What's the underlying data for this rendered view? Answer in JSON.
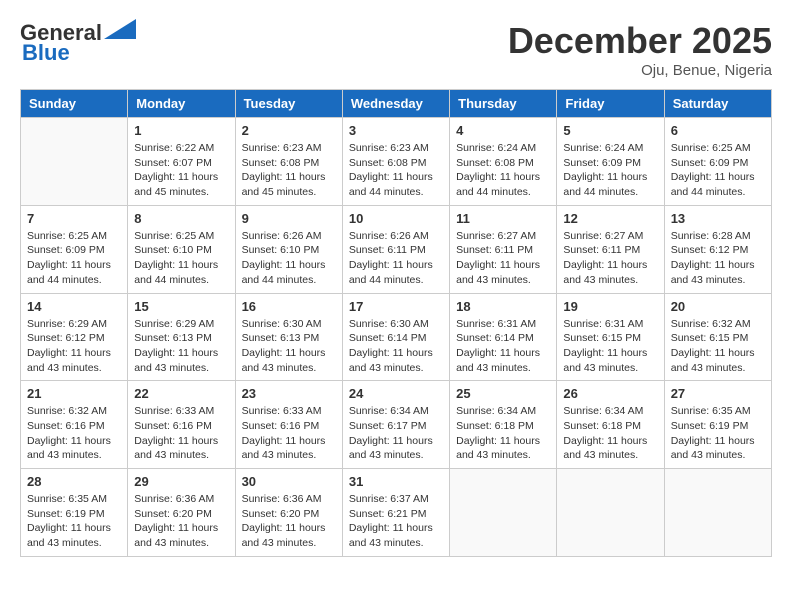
{
  "header": {
    "logo_line1": "General",
    "logo_line2": "Blue",
    "month": "December 2025",
    "location": "Oju, Benue, Nigeria"
  },
  "weekdays": [
    "Sunday",
    "Monday",
    "Tuesday",
    "Wednesday",
    "Thursday",
    "Friday",
    "Saturday"
  ],
  "weeks": [
    [
      {
        "day": "",
        "sunrise": "",
        "sunset": "",
        "daylight": ""
      },
      {
        "day": "1",
        "sunrise": "6:22 AM",
        "sunset": "6:07 PM",
        "daylight": "11 hours and 45 minutes."
      },
      {
        "day": "2",
        "sunrise": "6:23 AM",
        "sunset": "6:08 PM",
        "daylight": "11 hours and 45 minutes."
      },
      {
        "day": "3",
        "sunrise": "6:23 AM",
        "sunset": "6:08 PM",
        "daylight": "11 hours and 44 minutes."
      },
      {
        "day": "4",
        "sunrise": "6:24 AM",
        "sunset": "6:08 PM",
        "daylight": "11 hours and 44 minutes."
      },
      {
        "day": "5",
        "sunrise": "6:24 AM",
        "sunset": "6:09 PM",
        "daylight": "11 hours and 44 minutes."
      },
      {
        "day": "6",
        "sunrise": "6:25 AM",
        "sunset": "6:09 PM",
        "daylight": "11 hours and 44 minutes."
      }
    ],
    [
      {
        "day": "7",
        "sunrise": "6:25 AM",
        "sunset": "6:09 PM",
        "daylight": "11 hours and 44 minutes."
      },
      {
        "day": "8",
        "sunrise": "6:25 AM",
        "sunset": "6:10 PM",
        "daylight": "11 hours and 44 minutes."
      },
      {
        "day": "9",
        "sunrise": "6:26 AM",
        "sunset": "6:10 PM",
        "daylight": "11 hours and 44 minutes."
      },
      {
        "day": "10",
        "sunrise": "6:26 AM",
        "sunset": "6:11 PM",
        "daylight": "11 hours and 44 minutes."
      },
      {
        "day": "11",
        "sunrise": "6:27 AM",
        "sunset": "6:11 PM",
        "daylight": "11 hours and 43 minutes."
      },
      {
        "day": "12",
        "sunrise": "6:27 AM",
        "sunset": "6:11 PM",
        "daylight": "11 hours and 43 minutes."
      },
      {
        "day": "13",
        "sunrise": "6:28 AM",
        "sunset": "6:12 PM",
        "daylight": "11 hours and 43 minutes."
      }
    ],
    [
      {
        "day": "14",
        "sunrise": "6:29 AM",
        "sunset": "6:12 PM",
        "daylight": "11 hours and 43 minutes."
      },
      {
        "day": "15",
        "sunrise": "6:29 AM",
        "sunset": "6:13 PM",
        "daylight": "11 hours and 43 minutes."
      },
      {
        "day": "16",
        "sunrise": "6:30 AM",
        "sunset": "6:13 PM",
        "daylight": "11 hours and 43 minutes."
      },
      {
        "day": "17",
        "sunrise": "6:30 AM",
        "sunset": "6:14 PM",
        "daylight": "11 hours and 43 minutes."
      },
      {
        "day": "18",
        "sunrise": "6:31 AM",
        "sunset": "6:14 PM",
        "daylight": "11 hours and 43 minutes."
      },
      {
        "day": "19",
        "sunrise": "6:31 AM",
        "sunset": "6:15 PM",
        "daylight": "11 hours and 43 minutes."
      },
      {
        "day": "20",
        "sunrise": "6:32 AM",
        "sunset": "6:15 PM",
        "daylight": "11 hours and 43 minutes."
      }
    ],
    [
      {
        "day": "21",
        "sunrise": "6:32 AM",
        "sunset": "6:16 PM",
        "daylight": "11 hours and 43 minutes."
      },
      {
        "day": "22",
        "sunrise": "6:33 AM",
        "sunset": "6:16 PM",
        "daylight": "11 hours and 43 minutes."
      },
      {
        "day": "23",
        "sunrise": "6:33 AM",
        "sunset": "6:16 PM",
        "daylight": "11 hours and 43 minutes."
      },
      {
        "day": "24",
        "sunrise": "6:34 AM",
        "sunset": "6:17 PM",
        "daylight": "11 hours and 43 minutes."
      },
      {
        "day": "25",
        "sunrise": "6:34 AM",
        "sunset": "6:18 PM",
        "daylight": "11 hours and 43 minutes."
      },
      {
        "day": "26",
        "sunrise": "6:34 AM",
        "sunset": "6:18 PM",
        "daylight": "11 hours and 43 minutes."
      },
      {
        "day": "27",
        "sunrise": "6:35 AM",
        "sunset": "6:19 PM",
        "daylight": "11 hours and 43 minutes."
      }
    ],
    [
      {
        "day": "28",
        "sunrise": "6:35 AM",
        "sunset": "6:19 PM",
        "daylight": "11 hours and 43 minutes."
      },
      {
        "day": "29",
        "sunrise": "6:36 AM",
        "sunset": "6:20 PM",
        "daylight": "11 hours and 43 minutes."
      },
      {
        "day": "30",
        "sunrise": "6:36 AM",
        "sunset": "6:20 PM",
        "daylight": "11 hours and 43 minutes."
      },
      {
        "day": "31",
        "sunrise": "6:37 AM",
        "sunset": "6:21 PM",
        "daylight": "11 hours and 43 minutes."
      },
      {
        "day": "",
        "sunrise": "",
        "sunset": "",
        "daylight": ""
      },
      {
        "day": "",
        "sunrise": "",
        "sunset": "",
        "daylight": ""
      },
      {
        "day": "",
        "sunrise": "",
        "sunset": "",
        "daylight": ""
      }
    ]
  ],
  "labels": {
    "sunrise_prefix": "Sunrise: ",
    "sunset_prefix": "Sunset: ",
    "daylight_prefix": "Daylight: "
  }
}
